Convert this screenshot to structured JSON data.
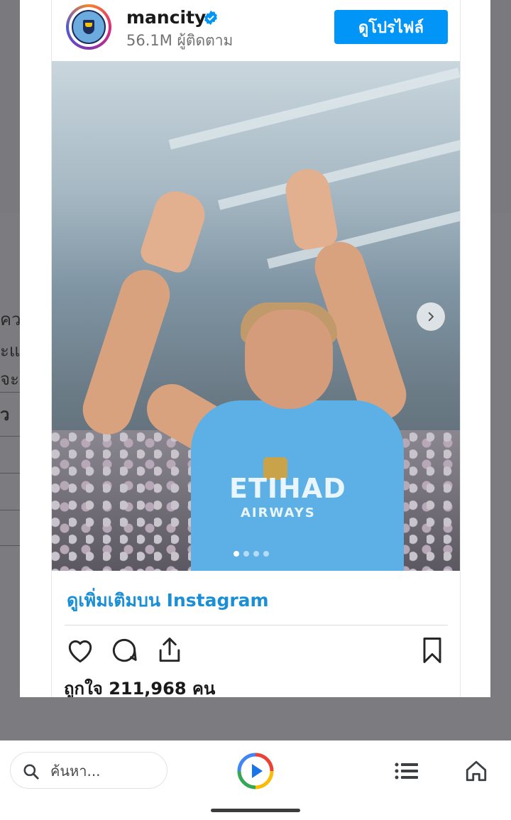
{
  "post": {
    "username": "mancity",
    "followers": "56.1M ผู้ติดตาม",
    "view_profile_label": "ดูโปรไฟล์",
    "more_on_instagram": "ดูเพิ่มเติมบน Instagram",
    "likes": "ถูกใจ 211,968 คน",
    "carousel": {
      "total": 4,
      "current": 1
    },
    "jersey_sponsor": "ETIHAD",
    "jersey_sponsor_sub": "AIRWAYS"
  },
  "background_fragments": [
    "ควา",
    "ะแ",
    "จะใ",
    "ว"
  ],
  "bottom_bar": {
    "search_placeholder": "ค้นหา..."
  },
  "colors": {
    "accent": "#0095f6",
    "link": "#1a8fd5",
    "jersey": "#5db0e6"
  },
  "icons": [
    "verified-icon",
    "chevron-right-icon",
    "heart-icon",
    "comment-icon",
    "share-icon",
    "bookmark-icon",
    "search-icon",
    "play-icon",
    "menu-icon",
    "home-icon"
  ]
}
